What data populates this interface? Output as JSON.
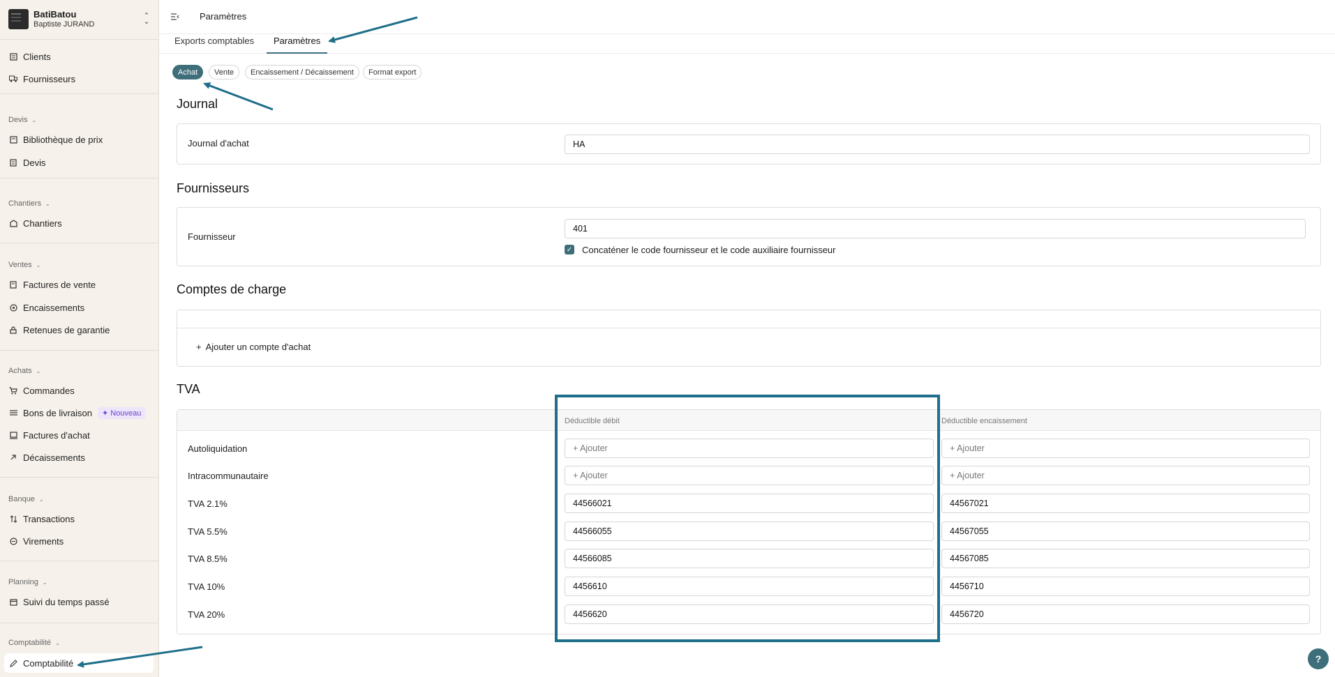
{
  "sidebar": {
    "org_name": "BatiBatou",
    "org_user": "Baptiste JURAND",
    "items": [
      {
        "label": "Clients",
        "icon": "clients-icon"
      },
      {
        "label": "Fournisseurs",
        "icon": "truck-icon"
      },
      {
        "label": "Bibliothèque de prix",
        "icon": "book-icon"
      },
      {
        "label": "Devis",
        "icon": "document-icon"
      },
      {
        "label": "Chantiers",
        "icon": "building-icon"
      },
      {
        "label": "Factures de vente",
        "icon": "invoice-icon"
      },
      {
        "label": "Encaissements",
        "icon": "coin-icon"
      },
      {
        "label": "Retenues de garantie",
        "icon": "lock-icon"
      },
      {
        "label": "Commandes",
        "icon": "cart-icon"
      },
      {
        "label": "Bons de livraison",
        "icon": "list-icon"
      },
      {
        "label": "Factures d'achat",
        "icon": "receipt-icon"
      },
      {
        "label": "Décaissements",
        "icon": "arrow-up-right-icon"
      },
      {
        "label": "Transactions",
        "icon": "arrows-updown-icon"
      },
      {
        "label": "Virements",
        "icon": "transfer-icon"
      },
      {
        "label": "Suivi du temps passé",
        "icon": "calendar-icon"
      },
      {
        "label": "Comptabilité",
        "icon": "pen-icon"
      }
    ],
    "sections": {
      "devis": "Devis",
      "chantiers": "Chantiers",
      "ventes": "Ventes",
      "achats": "Achats",
      "banque": "Banque",
      "planning": "Planning",
      "comptabilite": "Comptabilité"
    },
    "new_badge": "Nouveau"
  },
  "header": {
    "title": "Paramètres"
  },
  "tabs": [
    {
      "label": "Exports comptables",
      "active": false
    },
    {
      "label": "Paramètres",
      "active": true
    }
  ],
  "chips": [
    {
      "label": "Achat",
      "active": true
    },
    {
      "label": "Vente",
      "active": false
    },
    {
      "label": "Encaissement / Décaissement",
      "active": false
    },
    {
      "label": "Format export",
      "active": false
    }
  ],
  "journal": {
    "title": "Journal",
    "label": "Journal d'achat",
    "value": "HA"
  },
  "fournisseurs": {
    "title": "Fournisseurs",
    "label": "Fournisseur",
    "value": "401",
    "checkbox_label": "Concaténer le code fournisseur et le code auxiliaire fournisseur",
    "checkbox_checked": true
  },
  "comptes": {
    "title": "Comptes de charge",
    "add_label": "Ajouter un compte d'achat"
  },
  "tva": {
    "title": "TVA",
    "col_debit": "Déductible débit",
    "col_encaissement": "Déductible encaissement",
    "rows": [
      {
        "label": "Autoliquidation",
        "debit": "",
        "encaissement": ""
      },
      {
        "label": "Intracommunautaire",
        "debit": "",
        "encaissement": ""
      },
      {
        "label": "TVA 2.1%",
        "debit": "44566021",
        "encaissement": "44567021"
      },
      {
        "label": "TVA 5.5%",
        "debit": "44566055",
        "encaissement": "44567055"
      },
      {
        "label": "TVA 8.5%",
        "debit": "44566085",
        "encaissement": "44567085"
      },
      {
        "label": "TVA 10%",
        "debit": "4456610",
        "encaissement": "4456710"
      },
      {
        "label": "TVA 20%",
        "debit": "4456620",
        "encaissement": "4456720"
      }
    ],
    "placeholder": "+ Ajouter"
  },
  "help_label": "?",
  "colors": {
    "accent": "#3f6e7b",
    "annotation": "#1f6f8a",
    "sidebar_bg": "#f6f1ea"
  }
}
